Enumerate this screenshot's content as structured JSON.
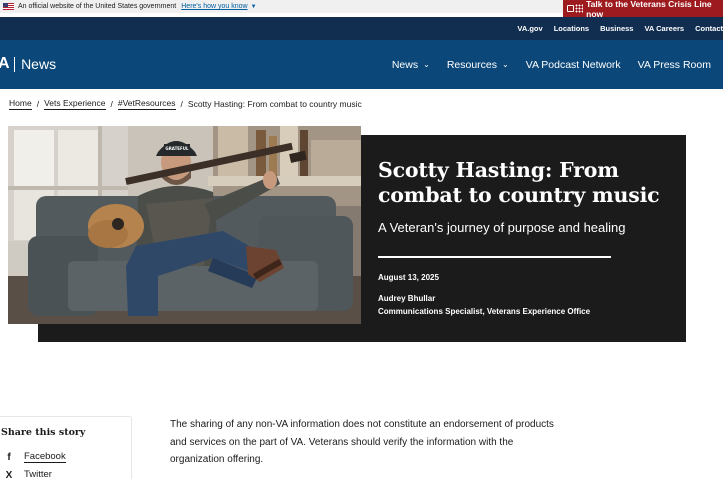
{
  "gov_banner": {
    "text": "An official website of the United States government",
    "link": "Here's how you know"
  },
  "crisis_line": {
    "label": "Talk to the Veterans Crisis Line now"
  },
  "utility_nav": [
    "VA.gov",
    "Locations",
    "Business",
    "VA Careers",
    "Contact"
  ],
  "brand": {
    "abbr": "A",
    "section": "News"
  },
  "main_nav": [
    {
      "label": "News",
      "has_menu": true
    },
    {
      "label": "Resources",
      "has_menu": true
    },
    {
      "label": "VA Podcast Network",
      "has_menu": false
    },
    {
      "label": "VA Press Room",
      "has_menu": false
    }
  ],
  "breadcrumb": {
    "links": [
      "Home",
      "Vets Experience",
      "#VetResources"
    ],
    "current": "Scotty Hasting: From combat to country music"
  },
  "hero": {
    "title": "Scotty Hasting: From combat to country music",
    "subtitle": "A Veteran's journey of purpose and healing",
    "date": "August 13, 2025",
    "author": "Audrey Bhullar",
    "author_role": "Communications Specialist, Veterans Experience Office",
    "cap_text": "GRATEFUL"
  },
  "share": {
    "title": "Share this story",
    "items": [
      {
        "label": "Facebook",
        "glyph": "f",
        "icon": "facebook-icon"
      },
      {
        "label": "Twitter",
        "glyph": "X",
        "icon": "x-twitter-icon"
      }
    ]
  },
  "article": {
    "disclaimer": "The sharing of any non-VA information does not constitute an endorsement of products and services on the part of VA. Veterans should verify the information with the organization offering."
  },
  "colors": {
    "utility_bg": "#112e51",
    "nav_bg": "#0b4778",
    "crisis_bg": "#9d1b1f",
    "hero_bg": "#1b1b1b"
  }
}
